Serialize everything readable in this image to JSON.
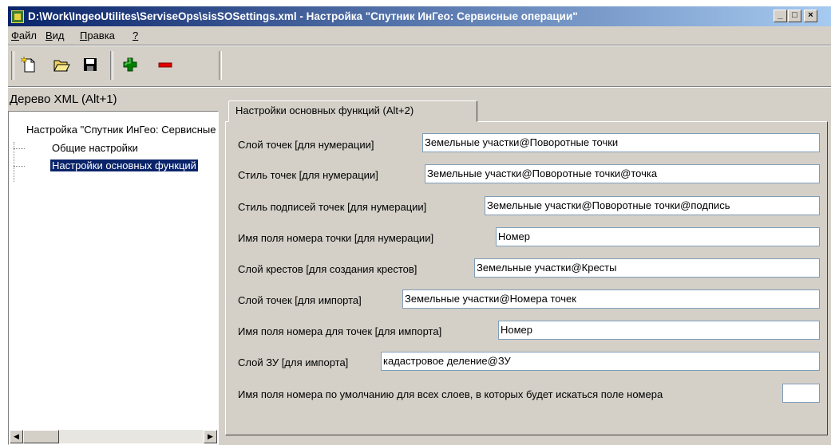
{
  "window": {
    "title": "D:\\Work\\IngeoUtilites\\ServiseOps\\sisSOSettings.xml - Настройка \"Спутник ИнГео: Сервисные операции\"",
    "caption_buttons": [
      "_",
      "□",
      "×"
    ]
  },
  "menu": [
    {
      "label": "Файл",
      "underline": "Ф",
      "rest": "айл"
    },
    {
      "label": "Вид",
      "underline": "В",
      "rest": "ид"
    },
    {
      "label": "Правка",
      "underline": "П",
      "rest": "равка"
    },
    {
      "label": "?",
      "underline": "?",
      "rest": ""
    }
  ],
  "toolbar": {
    "icons": [
      "new-file-icon",
      "open-folder-icon",
      "save-icon",
      "add-icon",
      "remove-icon"
    ],
    "colors": {
      "add": "#008000",
      "remove": "#e00000"
    }
  },
  "tree": {
    "header": "Дерево XML (Alt+1)",
    "root": "Настройка \"Спутник ИнГео: Сервисные операции\"",
    "items": [
      {
        "label": "Общие настройки",
        "selected": false
      },
      {
        "label": "Настройки основных функций",
        "selected": true
      }
    ]
  },
  "tab": {
    "label": "Настройки основных функций (Alt+2)"
  },
  "fields": [
    {
      "label": "Слой точек [для нумерации]",
      "value": "Земельные участки@Поворотные точки"
    },
    {
      "label": "Стиль точек [для нумерации]",
      "value": "Земельные участки@Поворотные точки@точка"
    },
    {
      "label": "Стиль подписей точек [для нумерации]",
      "value": "Земельные участки@Поворотные точки@подпись"
    },
    {
      "label": "Имя поля номера точки [для нумерации]",
      "value": "Номер"
    },
    {
      "label": "Слой крестов [для создания крестов]",
      "value": "Земельные участки@Кресты"
    },
    {
      "label": "Слой точек [для импорта]",
      "value": "Земельные участки@Номера точек"
    },
    {
      "label": "Имя поля номера для точек [для импорта]",
      "value": "Номер"
    },
    {
      "label": "Слой ЗУ [для импорта]",
      "value": "кадастровое деление@ЗУ"
    },
    {
      "label": "Имя поля номера по умолчанию для всех слоев, в которых будет искаться поле номера",
      "value": ""
    }
  ]
}
